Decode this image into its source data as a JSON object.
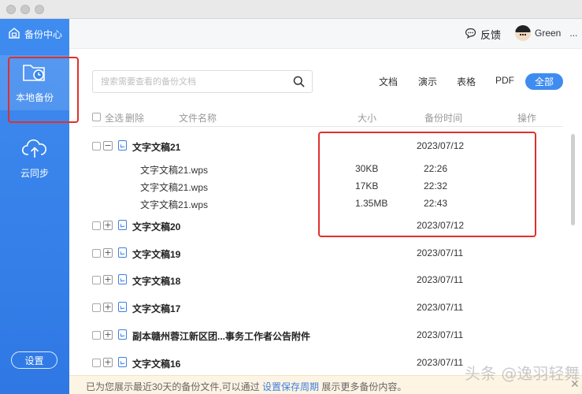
{
  "app": {
    "brand": "备份中心"
  },
  "sidebar": {
    "items": [
      {
        "label": "本地备份",
        "icon": "folder-clock-icon",
        "active": true
      },
      {
        "label": "云同步",
        "icon": "cloud-upload-icon",
        "active": false
      }
    ],
    "settings_label": "设置"
  },
  "topbar": {
    "feedback": "反馈",
    "user_name": "Green",
    "more": "..."
  },
  "search": {
    "placeholder": "搜索需要查看的备份文档"
  },
  "filters": {
    "doc": "文档",
    "ppt": "演示",
    "sheet": "表格",
    "pdf": "PDF",
    "all": "全部",
    "selected": "全部"
  },
  "table": {
    "headers": {
      "select_all": "全选",
      "delete": "删除",
      "name": "文件名称",
      "size": "大小",
      "time": "备份时间",
      "action": "操作"
    },
    "rows": [
      {
        "name": "文字文稿21",
        "date": "2023/07/12",
        "expanded": true,
        "children": [
          {
            "name": "文字文稿21.wps",
            "size": "30KB",
            "time": "22:26"
          },
          {
            "name": "文字文稿21.wps",
            "size": "17KB",
            "time": "22:32"
          },
          {
            "name": "文字文稿21.wps",
            "size": "1.35MB",
            "time": "22:43"
          }
        ]
      },
      {
        "name": "文字文稿20",
        "date": "2023/07/12",
        "expanded": false
      },
      {
        "name": "文字文稿19",
        "date": "2023/07/11",
        "expanded": false
      },
      {
        "name": "文字文稿18",
        "date": "2023/07/11",
        "expanded": false
      },
      {
        "name": "文字文稿17",
        "date": "2023/07/11",
        "expanded": false
      },
      {
        "name": "副本赣州蓉江新区团...事务工作者公告附件",
        "date": "2023/07/11",
        "expanded": false
      },
      {
        "name": "文字文稿16",
        "date": "2023/07/11",
        "expanded": false
      }
    ]
  },
  "notice": {
    "prefix": "已为您展示最近30天的备份文件,可以通过",
    "link": "设置保存周期",
    "suffix": "展示更多备份内容。"
  },
  "watermark": "头条 @逸羽轻舞",
  "colors": {
    "accent": "#3f8cf0",
    "highlight_box": "#e0302b"
  }
}
